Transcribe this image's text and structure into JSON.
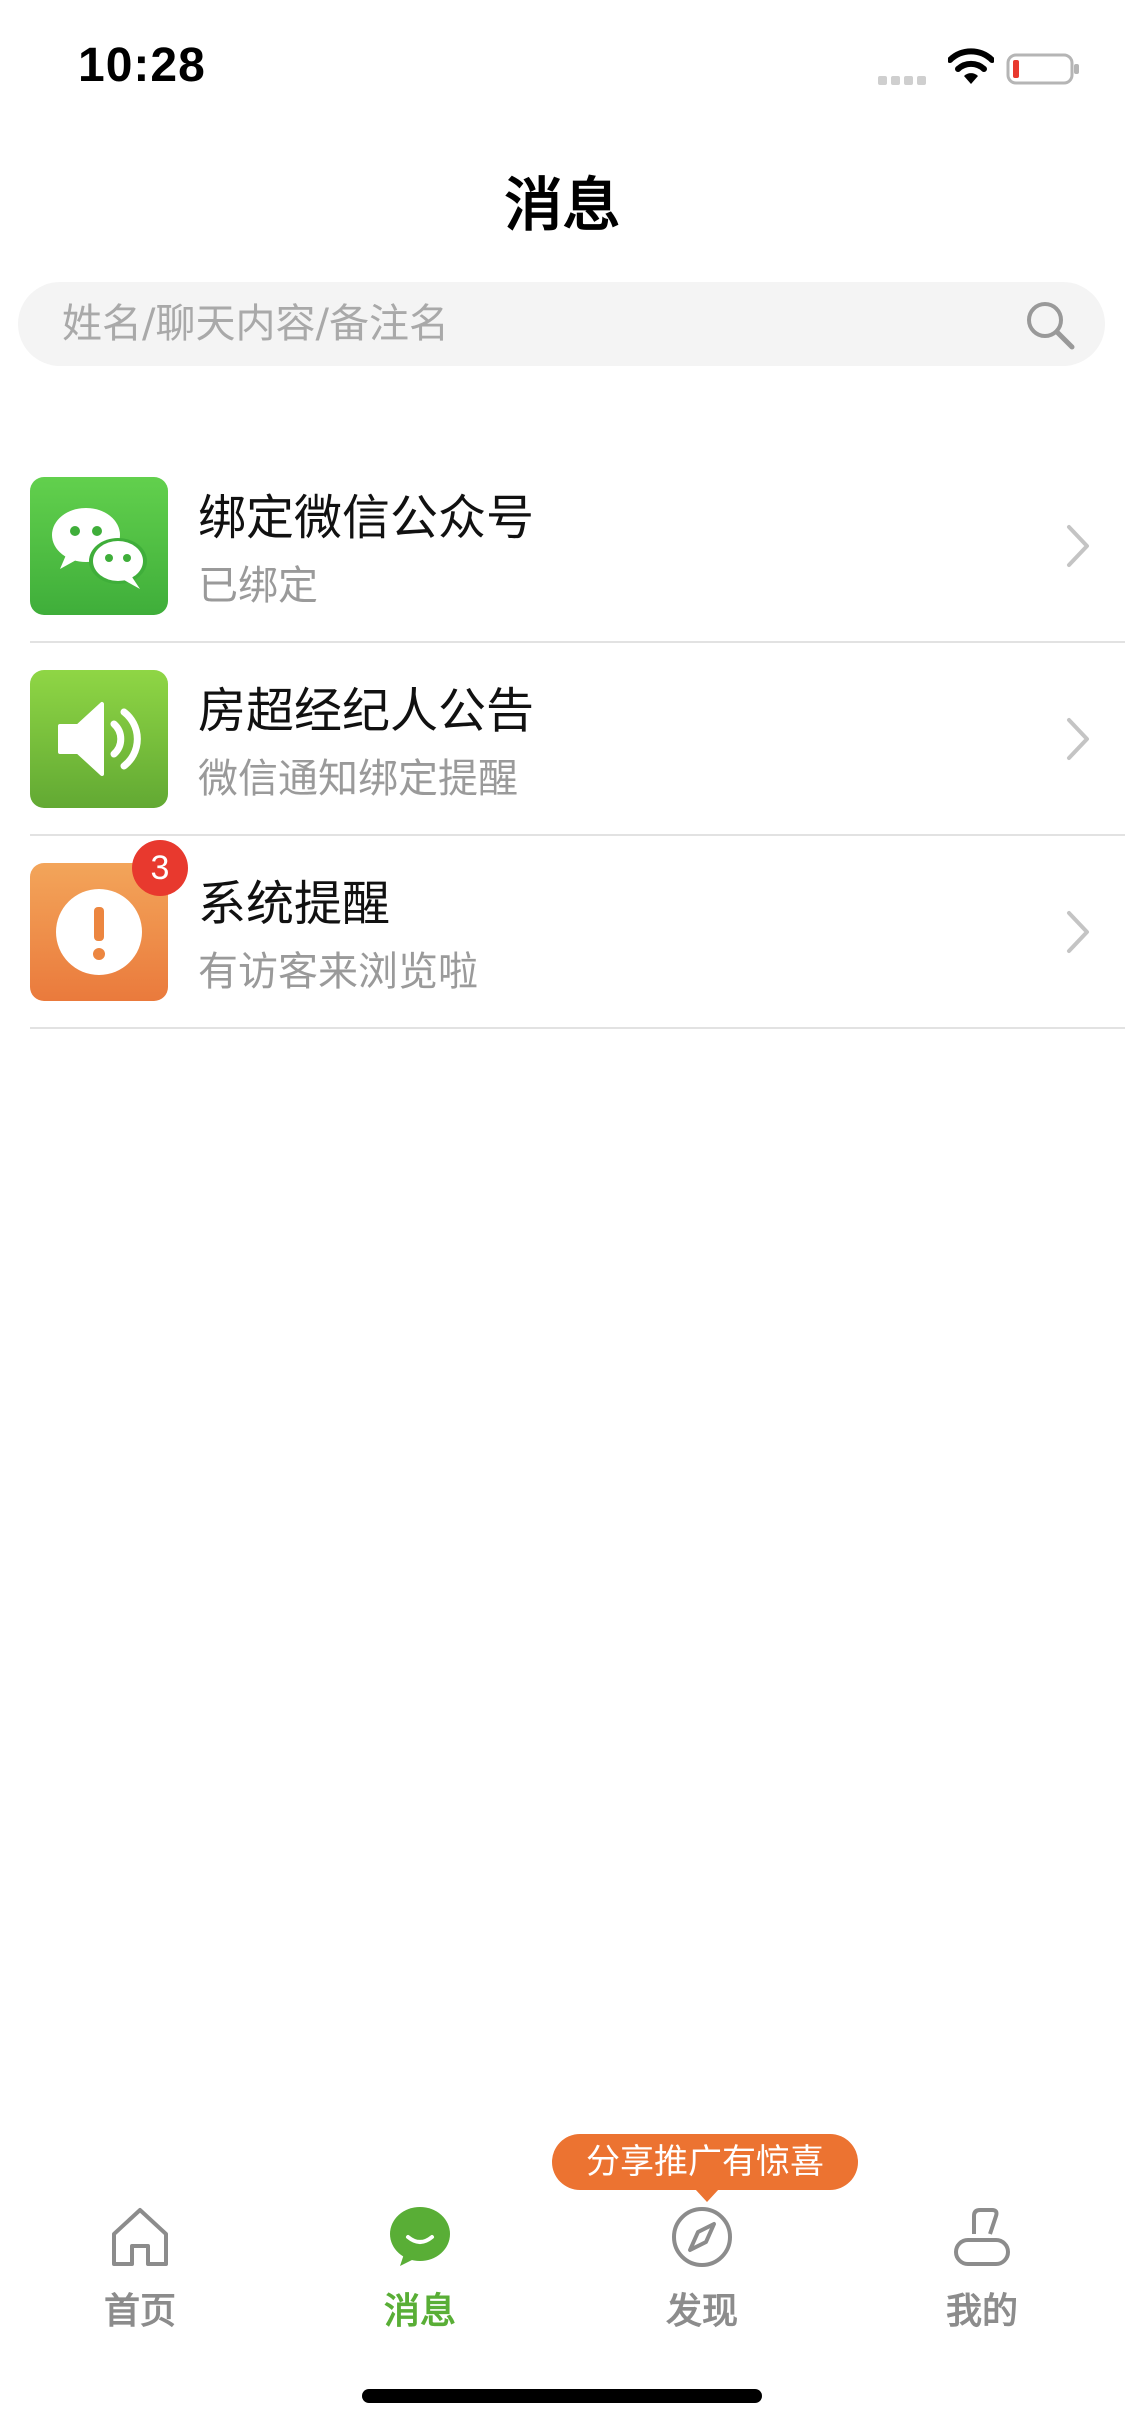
{
  "status_bar": {
    "time": "10:28"
  },
  "header": {
    "title": "消息"
  },
  "search": {
    "placeholder": "姓名/聊天内容/备注名",
    "value": ""
  },
  "messages": [
    {
      "title": "绑定微信公众号",
      "subtitle": "已绑定",
      "icon": "wechat-icon",
      "badge": ""
    },
    {
      "title": "房超经纪人公告",
      "subtitle": "微信通知绑定提醒",
      "icon": "speaker-icon",
      "badge": ""
    },
    {
      "title": "系统提醒",
      "subtitle": "有访客来浏览啦",
      "icon": "alert-icon",
      "badge": "3"
    }
  ],
  "promo": {
    "text": "分享推广有惊喜"
  },
  "tabs": [
    {
      "label": "首页",
      "icon": "home-icon",
      "active": false
    },
    {
      "label": "消息",
      "icon": "chat-icon",
      "active": true
    },
    {
      "label": "发现",
      "icon": "compass-icon",
      "active": false
    },
    {
      "label": "我的",
      "icon": "profile-icon",
      "active": false
    }
  ],
  "colors": {
    "accent_green": "#59ae36",
    "badge_red": "#e8392e",
    "promo_orange": "#ec7331",
    "inactive_gray": "#8c8c8c"
  }
}
